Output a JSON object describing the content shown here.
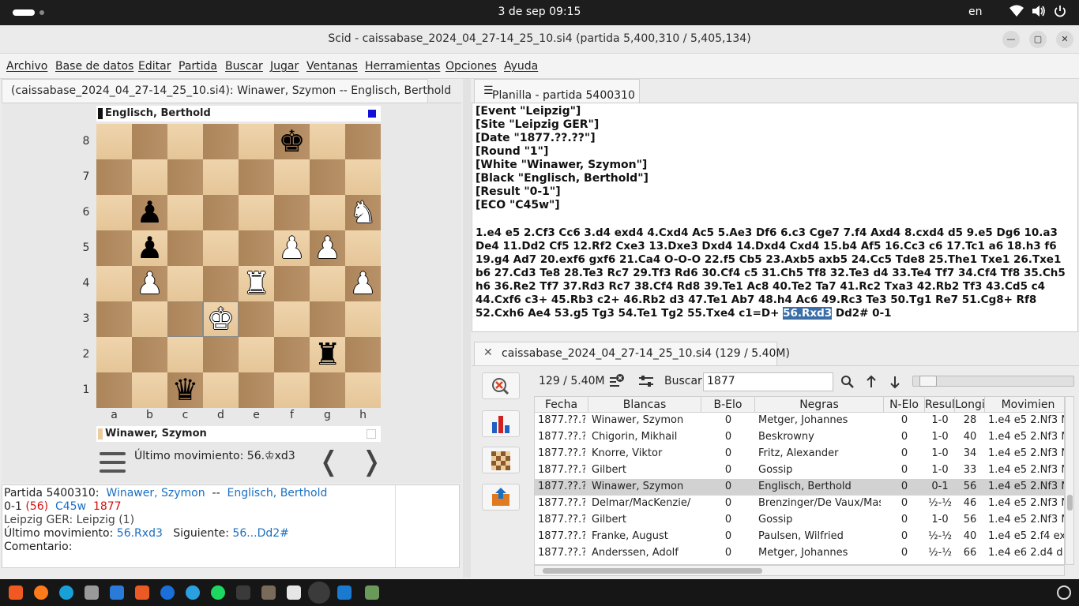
{
  "topbar": {
    "clock": "3 de sep  09:15",
    "lang": "en"
  },
  "window": {
    "title": "Scid - caissabase_2024_04_27-14_25_10.si4 (partida 5,400,310 / 5,405,134)"
  },
  "menu": [
    "Archivo",
    "Base de datos",
    "Editar",
    "Partida",
    "Buscar",
    "Jugar",
    "Ventanas",
    "Herramientas",
    "Opciones",
    "Ayuda"
  ],
  "board_tab": "(caissabase_2024_04_27-14_25_10.si4): Winawer, Szymon -- Englisch, Berthold",
  "board": {
    "top_player": "Englisch, Berthold",
    "bottom_player": "Winawer, Szymon",
    "ranks": [
      "8",
      "7",
      "6",
      "5",
      "4",
      "3",
      "2",
      "1"
    ],
    "files": [
      "a",
      "b",
      "c",
      "d",
      "e",
      "f",
      "g",
      "h"
    ],
    "pieces": [
      {
        "sq": "f8",
        "glyph": "♚",
        "color": "black",
        "name": "black-king"
      },
      {
        "sq": "b6",
        "glyph": "♟",
        "color": "black",
        "name": "black-pawn"
      },
      {
        "sq": "h6",
        "glyph": "♞",
        "color": "white",
        "name": "white-knight"
      },
      {
        "sq": "b5",
        "glyph": "♟",
        "color": "black",
        "name": "black-pawn"
      },
      {
        "sq": "f5",
        "glyph": "♟",
        "color": "white",
        "name": "white-pawn"
      },
      {
        "sq": "g5",
        "glyph": "♟",
        "color": "white",
        "name": "white-pawn"
      },
      {
        "sq": "b4",
        "glyph": "♟",
        "color": "white",
        "name": "white-pawn"
      },
      {
        "sq": "e4",
        "glyph": "♜",
        "color": "white",
        "name": "white-rook"
      },
      {
        "sq": "h4",
        "glyph": "♟",
        "color": "white",
        "name": "white-pawn"
      },
      {
        "sq": "d3",
        "glyph": "♚",
        "color": "white",
        "name": "white-king"
      },
      {
        "sq": "g2",
        "glyph": "♜",
        "color": "black",
        "name": "black-rook"
      },
      {
        "sq": "c1",
        "glyph": "♛",
        "color": "black",
        "name": "black-queen"
      }
    ],
    "highlight": [
      "c3",
      "d3"
    ],
    "last_move": "Último movimiento: 56.♔xd3",
    "prev": "❬",
    "next": "❭"
  },
  "gameinfo": {
    "partida_label": "Partida 5400310:",
    "white": "Winawer, Szymon",
    "sep": "--",
    "black": "Englisch, Berthold",
    "result": "0-1",
    "moves": "(56)",
    "eco": "C45w",
    "year": "1877",
    "site": "Leipzig GER:  Leipzig (1)",
    "last_label": "Último movimiento:",
    "last_move": "56.Rxd3",
    "next_label": "Siguiente:",
    "next_move": "56...Dd2#",
    "comment_label": "Comentario:"
  },
  "pgn": {
    "tab": "Planilla - partida 5400310",
    "headers": [
      "[Event \"Leipzig\"]",
      "[Site \"Leipzig GER\"]",
      "[Date \"1877.??.??\"]",
      "[Round \"1\"]",
      "[White \"Winawer, Szymon\"]",
      "[Black \"Englisch, Berthold\"]",
      "[Result \"0-1\"]",
      "[ECO \"C45w\"]"
    ],
    "moves_before": "1.e4 e5 2.Cf3 Cc6 3.d4 exd4 4.Cxd4 Ac5 5.Ae3 Df6 6.c3 Cge7 7.f4 Axd4 8.cxd4 d5 9.e5 Dg6 10.a3 De4 11.Dd2 Cf5 12.Rf2 Cxe3 13.Dxe3 Dxd4 14.Dxd4 Cxd4 15.b4 Af5 16.Cc3 c6 17.Tc1 a6 18.h3 f6 19.g4 Ad7 20.exf6 gxf6 21.Ca4 O-O-O 22.f5 Cb5 23.Axb5 axb5 24.Cc5 Tde8 25.The1 Txe1 26.Txe1 b6 27.Cd3 Te8 28.Te3 Rc7 29.Tf3 Rd6 30.Cf4 c5 31.Ch5 Tf8 32.Te3 d4 33.Te4 Tf7 34.Cf4 Tf8 35.Ch5 h6 36.Re2 Tf7 37.Rd3 Rc7 38.Cf4 Rd8 39.Te1 Ac8 40.Te2 Ta7 41.Rc2 Txa3 42.Rb2 Tf3 43.Cd5 c4 44.Cxf6 c3+ 45.Rb3 c2+ 46.Rb2 d3 47.Te1 Ab7 48.h4 Ac6 49.Rc3 Te3 50.Tg1 Re7 51.Cg8+ Rf8 52.Cxh6 Ae4 53.g5 Tg3 54.Te1 Tg2 55.Txe4 c1=D+",
    "current_move": "56.Rxd3",
    "moves_after": "Dd2# 0-1"
  },
  "db": {
    "tab": "caissabase_2024_04_27-14_25_10.si4 (129 / 5.40M)",
    "close": "✕",
    "count": "129 / 5.40M",
    "buscar_label": "Buscar",
    "buscar_value": "1877",
    "columns": [
      "Fecha",
      "Blancas",
      "B-Elo",
      "Negras",
      "N-Elo",
      "Resulta",
      "Longit",
      "Movimien"
    ],
    "rows": [
      [
        "1877.??.??",
        "Winawer, Szymon",
        "0",
        "Metger, Johannes",
        "0",
        "1-0",
        "28",
        "1.e4 e5  2.Nf3 N"
      ],
      [
        "1877.??.??",
        "Chigorin, Mikhail",
        "0",
        "Beskrowny",
        "0",
        "1-0",
        "40",
        "1.e4 e5  2.Nf3 N"
      ],
      [
        "1877.??.??",
        "Knorre, Viktor",
        "0",
        "Fritz, Alexander",
        "0",
        "1-0",
        "34",
        "1.e4 e5  2.Nf3 N"
      ],
      [
        "1877.??.??",
        "Gilbert",
        "0",
        "Gossip",
        "0",
        "1-0",
        "33",
        "1.e4 e5  2.Nf3 N"
      ],
      [
        "1877.??.??",
        "Winawer, Szymon",
        "0",
        "Englisch, Berthold",
        "0",
        "0-1",
        "56",
        "1.e4 e5  2.Nf3 N"
      ],
      [
        "1877.??.??",
        "Delmar/MacKenzie/",
        "0",
        "Brenzinger/De Vaux/Maso",
        "0",
        "½-½",
        "46",
        "1.e4 e5  2.Nf3 N"
      ],
      [
        "1877.??.??",
        "Gilbert",
        "0",
        "Gossip",
        "0",
        "1-0",
        "56",
        "1.e4 e5  2.Nf3 N"
      ],
      [
        "1877.??.??",
        "Franke, August",
        "0",
        "Paulsen, Wilfried",
        "0",
        "½-½",
        "40",
        "1.e4 e5  2.f4 ex"
      ],
      [
        "1877.??.??",
        "Anderssen, Adolf",
        "0",
        "Metger, Johannes",
        "0",
        "½-½",
        "66",
        "1.e4 e6  2.d4 d"
      ]
    ],
    "selected_row": 4
  },
  "colors": {
    "light_square": "#eccc9d",
    "dark_square": "#b38a5e",
    "link_blue": "#1a6fc2",
    "selection": "#3b6ea8"
  }
}
